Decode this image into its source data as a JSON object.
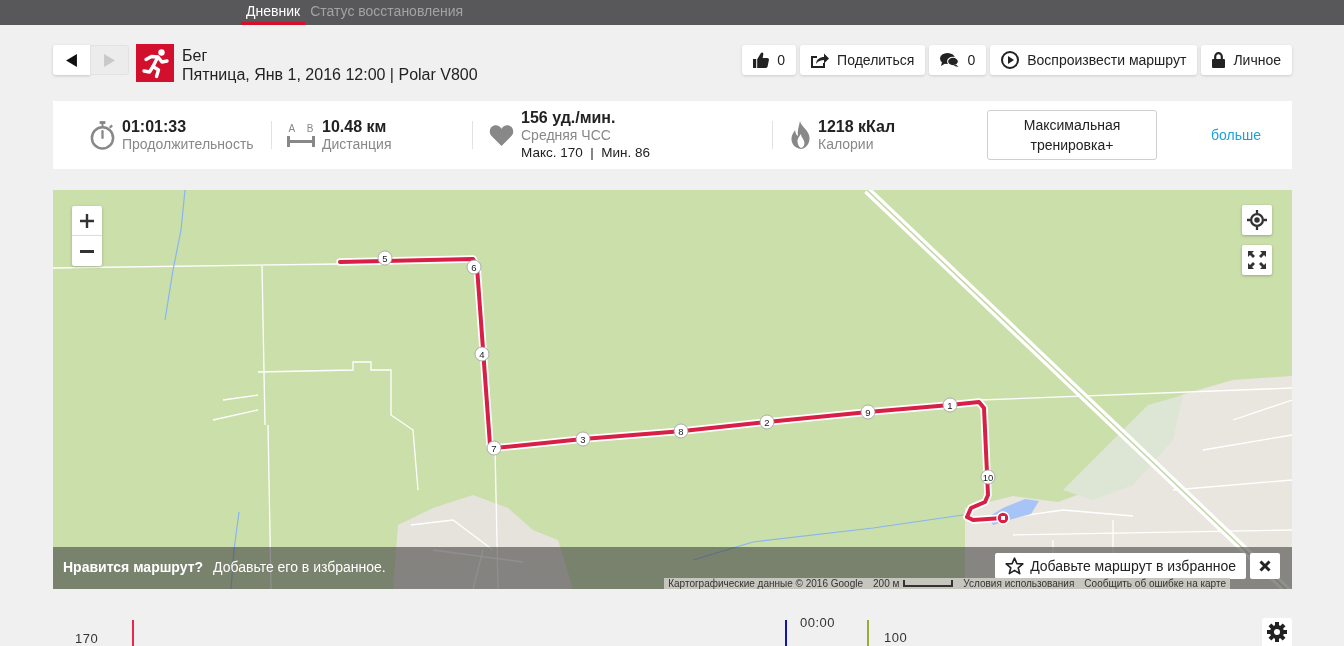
{
  "top_nav": {
    "tabs": [
      {
        "label": "Дневник",
        "selected": true
      },
      {
        "label": "Статус восстановления",
        "selected": false
      }
    ]
  },
  "header": {
    "pager": [
      {
        "kind": "prev",
        "disabled": false
      },
      {
        "kind": "next",
        "disabled": true
      }
    ],
    "sport": "Бег",
    "details": "Пятница, Янв 1, 2016 12:00 | Polar V800",
    "actions": [
      {
        "kind": "like",
        "label": "0"
      },
      {
        "kind": "share",
        "label": "Поделиться"
      },
      {
        "kind": "comment",
        "label": "0"
      },
      {
        "kind": "play",
        "label": "Воспроизвести маршрут"
      },
      {
        "kind": "lock",
        "label": "Личное"
      }
    ]
  },
  "summary": {
    "stats": [
      {
        "kind": "duration",
        "value": "01:01:33",
        "label": "Продолжительность"
      },
      {
        "kind": "distance",
        "value": "10.48 км",
        "label": "Дистанция",
        "icon_letters": [
          "A",
          "B"
        ]
      },
      {
        "kind": "heart_rate",
        "value": "156 уд./мин.",
        "label": "Средняя ЧСС",
        "detail": "Макс. 170  |  Мин. 86"
      },
      {
        "kind": "calories",
        "value": "1218 кКал",
        "label": "Калории"
      }
    ],
    "benefit_button": "Максимальная тренировка+",
    "more_link": "больше"
  },
  "map": {
    "route_markers": [
      "1",
      "2",
      "3",
      "4",
      "5",
      "6",
      "7",
      "8",
      "9",
      "10"
    ],
    "favorite_banner": {
      "question": "Нравится маршрут?",
      "hint": "Добавьте его в избранное.",
      "button": "Добавьте маршрут в избранное"
    },
    "attribution": [
      {
        "kind": "credit",
        "label": "Картографические данные © 2016 Google"
      },
      {
        "kind": "scale",
        "label": "200 м"
      },
      {
        "kind": "terms",
        "label": "Условия использования"
      },
      {
        "kind": "report",
        "label": "Сообщить об ошибке на карте"
      }
    ]
  },
  "chart": {
    "cursors": [
      {
        "label": "170",
        "color": "#e8264f"
      },
      {
        "label": "00:00",
        "color": "#1414b4"
      },
      {
        "label": "100",
        "color": "#9aab3c"
      }
    ]
  }
}
